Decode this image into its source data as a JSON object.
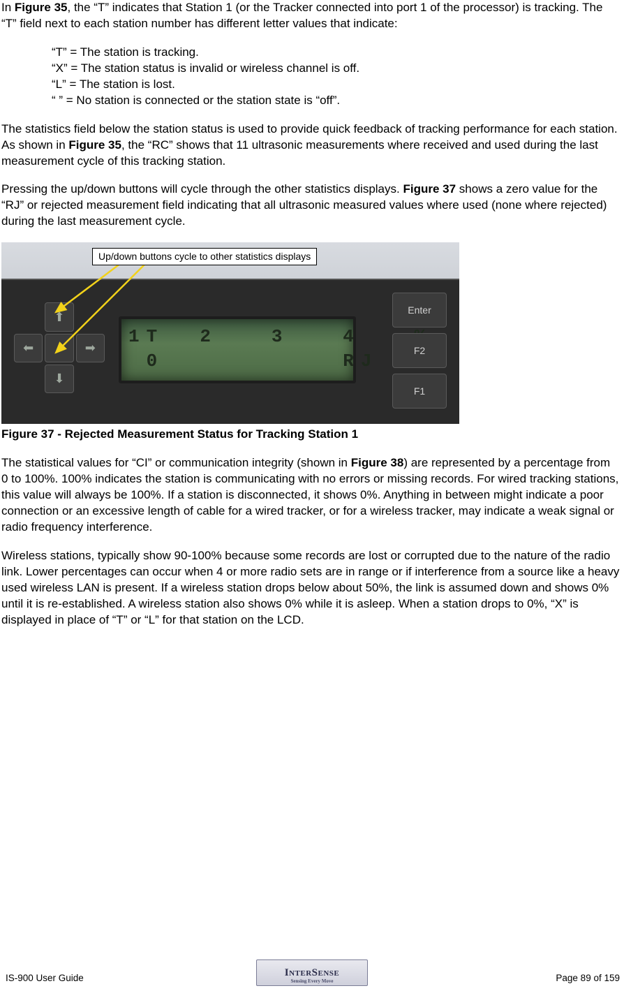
{
  "para1": {
    "pre": "In ",
    "fig_a": "Figure 35",
    "post": ", the “T” indicates that Station 1 (or the Tracker connected into port 1 of the processor) is tracking.  The “T” field next to each station number has different letter values that indicate:"
  },
  "status_list": {
    "t": "“T” = The station is tracking.",
    "x": "“X” = The station status is invalid or wireless channel is off.",
    "l": "“L” = The station is lost.",
    "blank": "“  ” = No station is connected or the station state is “off”."
  },
  "para2": {
    "pre": "The statistics field below the station status is used to provide quick feedback of tracking performance for each station.  As shown in ",
    "fig_a": "Figure 35",
    "post": ", the “RC” shows that 11 ultrasonic measurements where received and used during the last measurement cycle of this tracking station."
  },
  "para3": {
    "pre": "Pressing the up/down buttons will cycle through the other statistics displays.  ",
    "fig_a": "Figure 37",
    "post": " shows a zero value for the “RJ” or rejected measurement field indicating that all ultrasonic measured values where used (none where rejected) during the last measurement cycle."
  },
  "device": {
    "callout": "Up/down buttons cycle to other statistics displays",
    "lcd_line1": "1T  2   3   4   %",
    "lcd_line2": " 0          RJ",
    "btn_up": "⬆",
    "btn_down": "⬇",
    "btn_left": "⬅",
    "btn_right": "➡",
    "btn_enter": "Enter",
    "btn_f2": "F2",
    "btn_f1": "F1"
  },
  "fig37_caption": "Figure 37 - Rejected Measurement Status for Tracking Station 1",
  "para4": {
    "pre": "The statistical values for “CI” or communication integrity (shown in ",
    "fig_a": "Figure 38",
    "post": ") are represented by a percentage from 0 to 100%.  100% indicates the station is communicating with no errors or missing records.  For wired tracking stations, this value will always be 100%.  If a station is disconnected, it shows 0%.  Anything in between might indicate a poor connection or an excessive length of cable for a wired tracker, or for a wireless tracker, may indicate a weak signal or radio frequency interference."
  },
  "para5": "Wireless stations, typically show 90-100% because some records are lost or corrupted due to the nature of the radio link.  Lower percentages can occur when 4 or more radio sets are in range or if interference from a source like a heavy used wireless LAN is present.  If a wireless station drops below about 50%, the link is assumed down and shows 0% until it is re-established.  A wireless station also shows 0% while it is asleep.  When a station drops to 0%, “X” is displayed in place of “T” or “L” for that station on the LCD.",
  "footer": {
    "left": "IS-900 User Guide",
    "right": "Page 89 of 159",
    "logo_main": "InterSense",
    "logo_tag": "Sensing Every Move"
  }
}
